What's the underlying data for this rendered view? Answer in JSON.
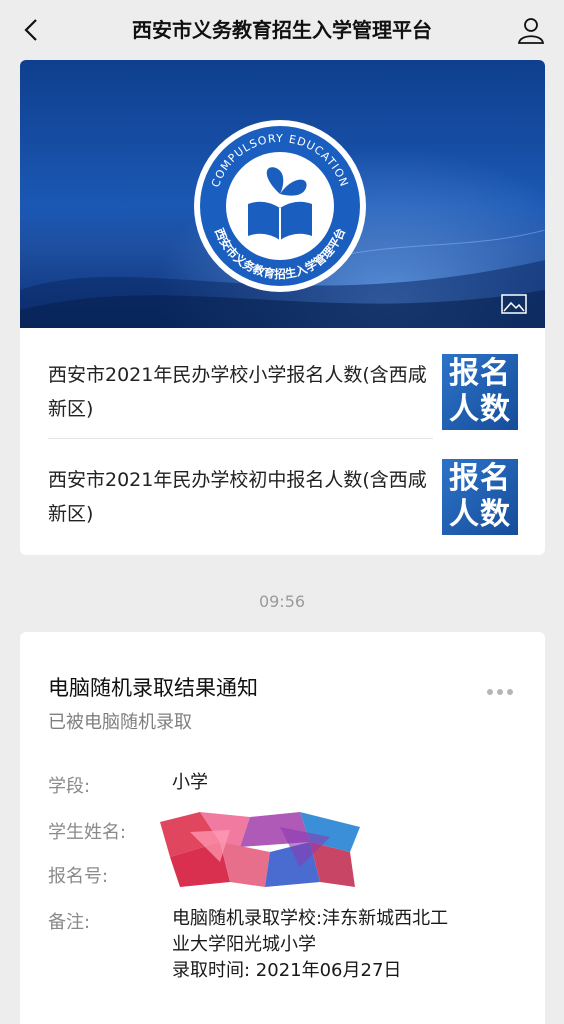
{
  "header": {
    "title": "西安市义务教育招生入学管理平台",
    "back_icon": "chevron-left-icon",
    "profile_icon": "user-icon"
  },
  "banner": {
    "logo_text_top": "COMPULSORY EDUCATION",
    "logo_text_bottom": "西安市义务教育招生入学管理平台",
    "image_icon": "image-icon"
  },
  "articles": [
    {
      "title": "西安市2021年民办学校小学报名人数(含西咸新区)",
      "thumb_text": "报名人数"
    },
    {
      "title": "西安市2021年民办学校初中报名人数(含西咸新区)",
      "thumb_text": "报名人数"
    }
  ],
  "timestamp": "09:56",
  "notice": {
    "title": "电脑随机录取结果通知",
    "subtitle": "已被电脑随机录取",
    "fields": [
      {
        "label": "学段:",
        "value": "小学"
      },
      {
        "label": "学生姓名:",
        "value": ""
      },
      {
        "label": "报名号:",
        "value": ""
      },
      {
        "label": "备注:",
        "value_lines": [
          "电脑随机录取学校:沣东新城西北工",
          "业大学阳光城小学",
          "录取时间: 2021年06月27日"
        ]
      }
    ]
  }
}
